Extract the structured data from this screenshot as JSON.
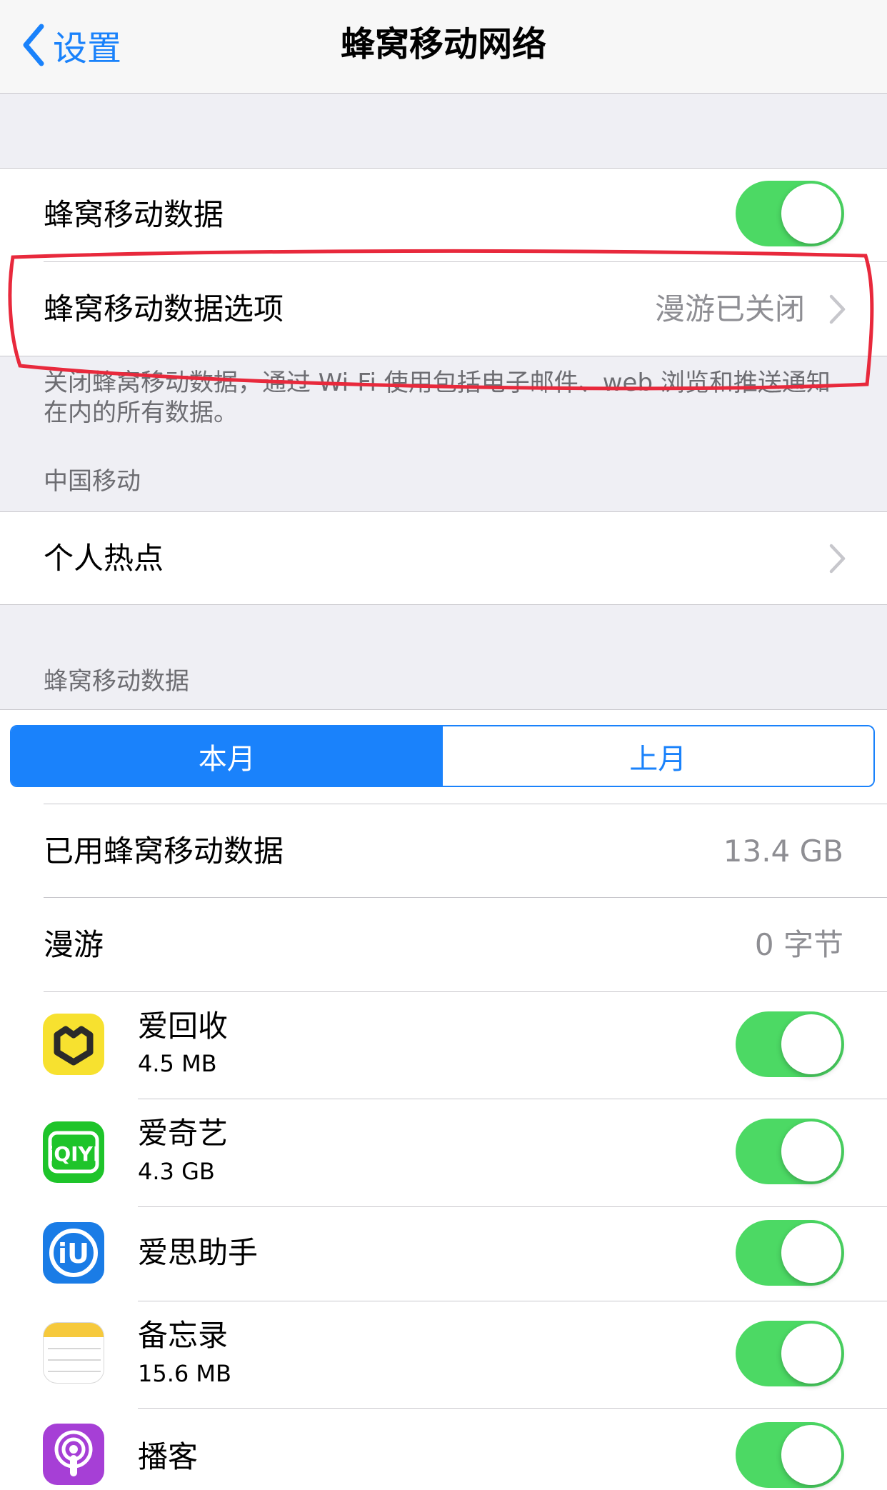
{
  "nav": {
    "back_label": "设置",
    "title": "蜂窝移动网络"
  },
  "cellular": {
    "data_label": "蜂窝移动数据",
    "data_toggle": "on",
    "options_label": "蜂窝移动数据选项",
    "options_value": "漫游已关闭",
    "footer": "关闭蜂窝移动数据，通过 Wi-Fi 使用包括电子邮件、web 浏览和推送通知在内的所有数据。"
  },
  "carrier": {
    "section_title": "中国移动",
    "hotspot_label": "个人热点"
  },
  "usage": {
    "section_title": "蜂窝移动数据",
    "segments": [
      "本月",
      "上月"
    ],
    "selected_segment": "本月",
    "used_label": "已用蜂窝移动数据",
    "used_value": "13.4 GB",
    "roaming_label": "漫游",
    "roaming_value": "0 字节"
  },
  "apps": [
    {
      "name": "爱回收",
      "size": "4.5 MB",
      "icon": "aihuishou-icon",
      "toggle": "on"
    },
    {
      "name": "爱奇艺",
      "size": "4.3 GB",
      "icon": "iqiyi-icon",
      "toggle": "on"
    },
    {
      "name": "爱思助手",
      "size": "",
      "icon": "i4-icon",
      "toggle": "on"
    },
    {
      "name": "备忘录",
      "size": "15.6 MB",
      "icon": "notes-icon",
      "toggle": "on"
    },
    {
      "name": "播客",
      "size": "",
      "icon": "podcasts-icon",
      "toggle": "on"
    }
  ],
  "annotation": {
    "color": "#e8293c",
    "target": "cellular-data-options-row"
  },
  "colors": {
    "accent": "#1a82fb",
    "toggle_on": "#4cd964",
    "background": "#efeff4"
  }
}
